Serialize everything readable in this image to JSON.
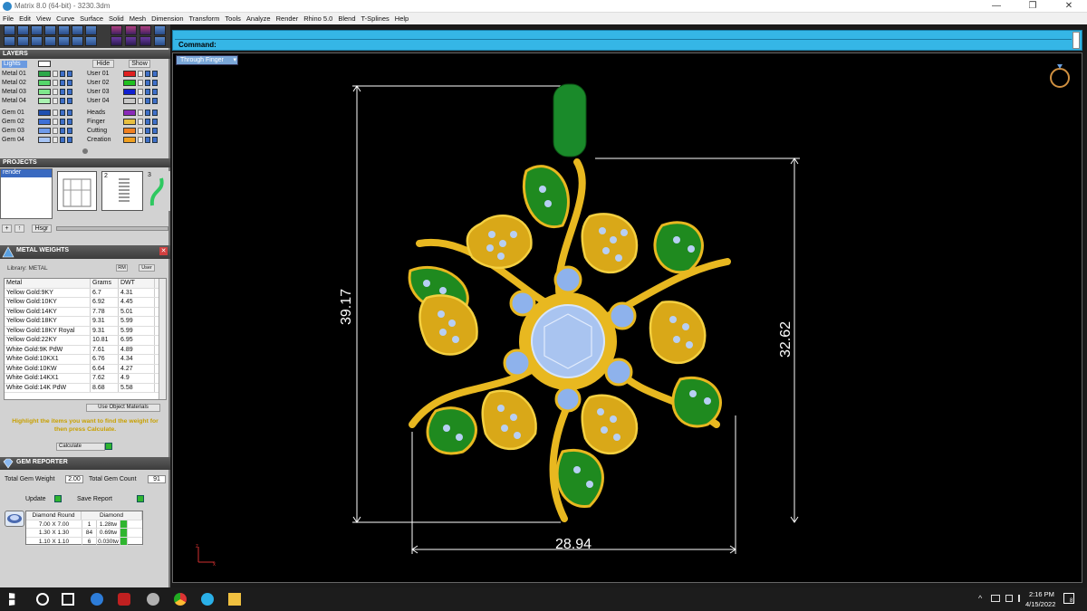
{
  "window": {
    "title": "Matrix 8.0 (64-bit) - 3230.3dm"
  },
  "menu": [
    "File",
    "Edit",
    "View",
    "Curve",
    "Surface",
    "Solid",
    "Mesh",
    "Dimension",
    "Transform",
    "Tools",
    "Analyze",
    "Render",
    "Rhino 5.0",
    "Blend",
    "T-Splines",
    "Help"
  ],
  "command": {
    "label": "Command:"
  },
  "viewport": {
    "tab": "Through Finger",
    "dims": {
      "height_left": "39.17",
      "height_right": "32.62",
      "width": "28.94"
    },
    "axis": {
      "z": "z",
      "x": "x"
    }
  },
  "layers": {
    "header": "LAYERS",
    "lights": "Lights",
    "hide": "Hide",
    "show": "Show",
    "left": [
      {
        "name": "Metal 01",
        "color": "#2da84a"
      },
      {
        "name": "Metal 02",
        "color": "#55d66a"
      },
      {
        "name": "Metal 03",
        "color": "#7fe88c"
      },
      {
        "name": "Metal 04",
        "color": "#a9f2b0"
      },
      {
        "name": "Gem 01",
        "color": "#1f4fb0"
      },
      {
        "name": "Gem 02",
        "color": "#3d6fd6"
      },
      {
        "name": "Gem 03",
        "color": "#6e9aea"
      },
      {
        "name": "Gem 04",
        "color": "#a7c4f4"
      }
    ],
    "right": [
      {
        "name": "User 01",
        "color": "#e02020"
      },
      {
        "name": "User 02",
        "color": "#20c020"
      },
      {
        "name": "User 03",
        "color": "#1020d0"
      },
      {
        "name": "User 04",
        "color": "#c8c8c8"
      },
      {
        "name": "Heads",
        "color": "#8a2ab8"
      },
      {
        "name": "Finger",
        "color": "#e8c040"
      },
      {
        "name": "Cutting",
        "color": "#f08020"
      },
      {
        "name": "Creation",
        "color": "#f0a020"
      }
    ]
  },
  "projects": {
    "header": "PROJECTS",
    "item": "render",
    "thumbs": [
      "2",
      "3"
    ],
    "btn": "Hsgr"
  },
  "metal_weights": {
    "header": "METAL WEIGHTS",
    "library": "Library: METAL",
    "rm": "RM",
    "user": "User",
    "cols": [
      "Metal",
      "Grams",
      "DWT"
    ],
    "rows": [
      [
        "Yellow Gold:9KY",
        "6.7",
        "4.31"
      ],
      [
        "Yellow Gold:10KY",
        "6.92",
        "4.45"
      ],
      [
        "Yellow Gold:14KY",
        "7.78",
        "5.01"
      ],
      [
        "Yellow Gold:18KY",
        "9.31",
        "5.99"
      ],
      [
        "Yellow Gold:18KY Royal",
        "9.31",
        "5.99"
      ],
      [
        "Yellow Gold:22KY",
        "10.81",
        "6.95"
      ],
      [
        "White Gold:9K PdW",
        "7.61",
        "4.89"
      ],
      [
        "White Gold:10KX1",
        "6.76",
        "4.34"
      ],
      [
        "White Gold:10KW",
        "6.64",
        "4.27"
      ],
      [
        "White Gold:14KX1",
        "7.62",
        "4.9"
      ],
      [
        "White Gold:14K PdW",
        "8.68",
        "5.58"
      ]
    ],
    "use_obj": "Use Object Materials",
    "hint": "Highlight the items you want to find the weight for then press Calculate.",
    "calc": "Calculate"
  },
  "gem_reporter": {
    "header": "GEM REPORTER",
    "total_weight_label": "Total Gem Weight",
    "total_weight": "2.00",
    "total_count_label": "Total Gem Count",
    "total_count": "91",
    "update": "Update",
    "save": "Save Report",
    "cols": [
      "Diamond Round",
      "Diamond"
    ],
    "rows": [
      [
        "7.00 X 7.00",
        "1",
        "1.28tw"
      ],
      [
        "1.30 X 1.30",
        "84",
        "0.69tw"
      ],
      [
        "1.10 X 1.10",
        "6",
        "0.030tw"
      ]
    ]
  },
  "taskbar": {
    "time": "2:16 PM",
    "date": "4/15/2022",
    "notif": "8"
  },
  "colors": {
    "cmd": "#35b6e6",
    "gold": "#e8b820",
    "enamel": "#1f8a1f",
    "gem": "#a9c4f0"
  }
}
